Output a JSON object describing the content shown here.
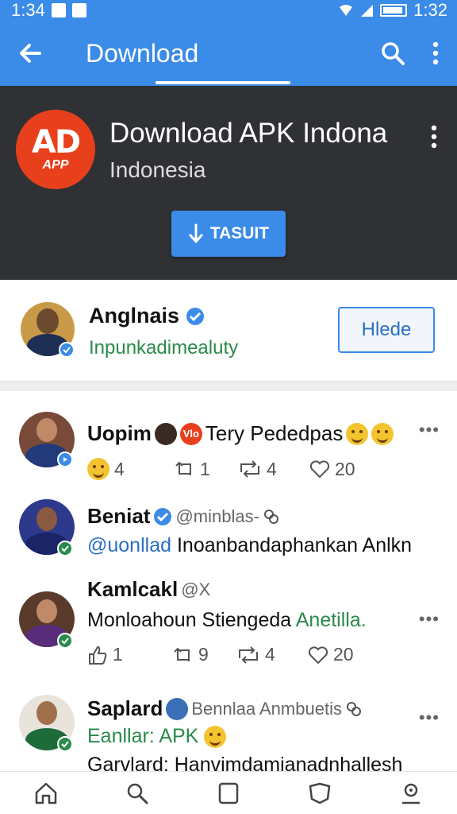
{
  "status_bar": {
    "time_left": "1:34",
    "time_right": "1:32"
  },
  "app_bar": {
    "title": "Download"
  },
  "header": {
    "app_name": "Download APK Indona",
    "region": "Indonesia",
    "logo_text": "AD",
    "logo_sub": "APP",
    "download_label": "TASUIT"
  },
  "profile": {
    "name": "Anglnais",
    "handle": "Inpunkadimealuty",
    "follow_label": "Hlede"
  },
  "posts": [
    {
      "author": "Uopim",
      "badge_text": "Vlo",
      "text": "Tery Pededpas",
      "actions": {
        "reactions": "4",
        "replies": "1",
        "reposts": "4",
        "likes": "20"
      }
    },
    {
      "author": "Beniat",
      "handle": "@minblas-",
      "mention": "@uonllad",
      "text": "Inoanbandaphankan Anlkn"
    },
    {
      "author": "Kamlcakl",
      "handle": "@X",
      "text": "Monloahoun Stiengeda",
      "highlight": "Anetilla.",
      "actions": {
        "replies": "1",
        "reposts_a": "9",
        "reposts_b": "4",
        "likes": "20"
      }
    },
    {
      "author": "Saplard",
      "handle": "Bennlaa Anmbuetis",
      "line2": "Eanllar: APK",
      "line3": "Garvlard: Hanvimdamianadnhallesh"
    }
  ],
  "colors": {
    "accent": "#3b8be8",
    "header_bg": "#2f3134",
    "logo": "#e8401c",
    "green_text": "#2a8a4a"
  },
  "icons": [
    "back-arrow-icon",
    "search-icon",
    "more-vert-icon",
    "download-arrow-icon",
    "verified-icon",
    "home-icon",
    "bookmark-icon",
    "chat-icon",
    "profile-icon"
  ]
}
